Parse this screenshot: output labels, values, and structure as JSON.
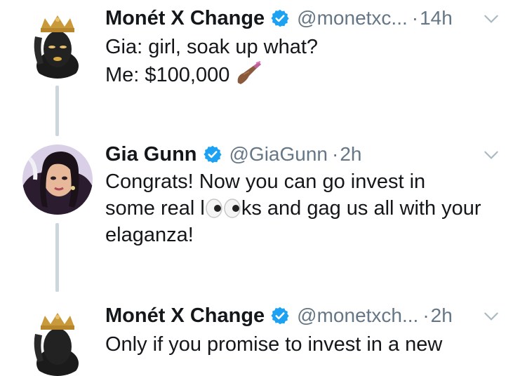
{
  "tweets": [
    {
      "name": "Monét X Change",
      "handle": "@monetxc...",
      "dot": "·",
      "time": "14h",
      "text_lines": [
        "Gia: girl, soak up what?",
        "Me: $100,000"
      ],
      "avatar_icon": "drag-queen-gold-crown-avatar"
    },
    {
      "name": "Gia Gunn",
      "handle": "@GiaGunn",
      "dot": "·",
      "time": "2h",
      "text_lines": [
        "Congrats!  Now you can go invest in",
        "some real l",
        "ks and gag us all with your",
        "elaganza!"
      ],
      "avatar_icon": "gia-gunn-photo-avatar"
    },
    {
      "name": "Monét X Change",
      "handle": "@monetxch...",
      "dot": "·",
      "time": "2h",
      "text_lines": [
        "Only if you promise to invest in a new"
      ],
      "avatar_icon": "drag-queen-gold-crown-avatar"
    }
  ],
  "colors": {
    "verified": "#1da1f2",
    "muted": "#657786",
    "thread_line": "#ccd6dd",
    "text": "#14171a"
  }
}
